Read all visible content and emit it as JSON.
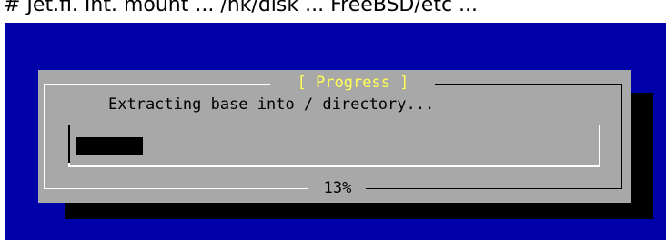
{
  "top_text": "# Jet.fi. Int. mount ... /nk/disk ... FreeBSD/etc ...",
  "dialog": {
    "title": "[ Progress ]",
    "message": "Extracting base into / directory...",
    "percent_label": "13%",
    "progress_value": 0.13
  },
  "colors": {
    "screen_background": "#0000a8",
    "dialog_background": "#a8a8a8",
    "title_color": "#ffff55",
    "bar_fill": "#000000"
  }
}
